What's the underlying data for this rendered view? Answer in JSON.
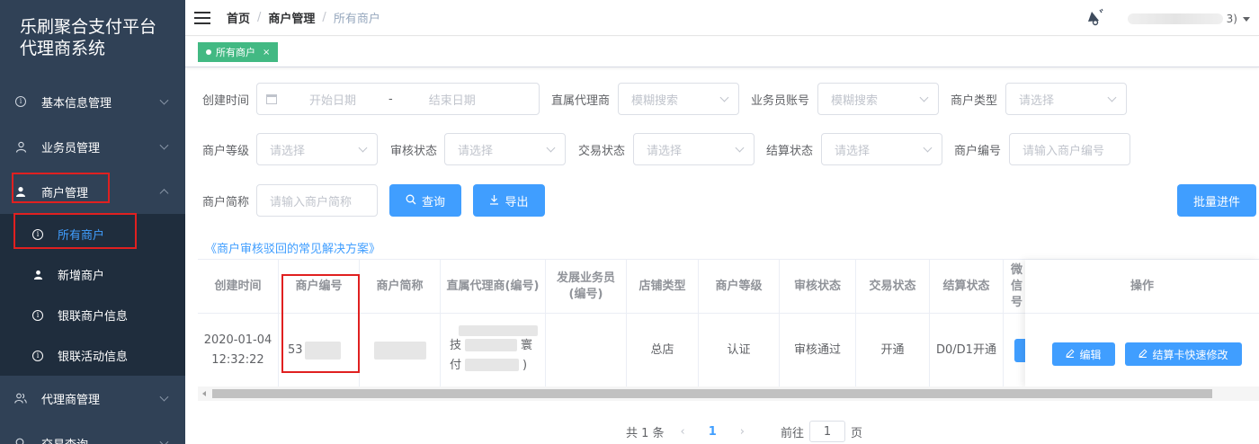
{
  "sidebar": {
    "brand_line1": "乐刷聚合支付平台",
    "brand_line2": "代理商系统",
    "items": [
      {
        "label": "基本信息管理"
      },
      {
        "label": "业务员管理"
      },
      {
        "label": "商户管理"
      },
      {
        "label": "代理商管理"
      },
      {
        "label": "交易查询"
      }
    ],
    "submenu": [
      {
        "label": "所有商户"
      },
      {
        "label": "新增商户"
      },
      {
        "label": "银联商户信息"
      },
      {
        "label": "银联活动信息"
      }
    ]
  },
  "header": {
    "breadcrumb": [
      "首页",
      "商户管理",
      "所有商户"
    ],
    "user_suffix": "3)"
  },
  "tags": [
    {
      "label": "所有商户",
      "close": "×"
    }
  ],
  "filters": {
    "create_time_label": "创建时间",
    "start_placeholder": "开始日期",
    "end_placeholder": "结束日期",
    "range_sep": "-",
    "agent_label": "直属代理商",
    "agent_placeholder": "模糊搜索",
    "salesman_label": "业务员账号",
    "salesman_placeholder": "模糊搜索",
    "merchant_type_label": "商户类型",
    "merchant_type_placeholder": "请选择",
    "level_label": "商户等级",
    "level_placeholder": "请选择",
    "audit_label": "审核状态",
    "audit_placeholder": "请选择",
    "trade_label": "交易状态",
    "trade_placeholder": "请选择",
    "settle_label": "结算状态",
    "settle_placeholder": "请选择",
    "merchant_no_label": "商户编号",
    "merchant_no_placeholder": "请输入商户编号",
    "short_name_label": "商户简称",
    "short_name_placeholder": "请输入商户简称"
  },
  "buttons": {
    "query": "查询",
    "export": "导出",
    "batch": "批量进件"
  },
  "help_link": "《商户审核驳回的常见解决方案》",
  "table": {
    "headers": [
      "创建时间",
      "商户编号",
      "商户简称",
      "直属代理商(编号)",
      "发展业务员(编号)",
      "店铺类型",
      "商户等级",
      "审核状态",
      "交易状态",
      "结算状态",
      "微信号",
      "操作"
    ],
    "row": {
      "create_date": "2020-01-04",
      "create_time": "12:32:22",
      "merchant_no_prefix": "53",
      "agent_part1": "技",
      "agent_part2": "寰",
      "agent_part3": "付",
      "agent_part4": ")",
      "shop_type": "总店",
      "level": "认证",
      "audit": "审核通过",
      "trade": "开通",
      "settle": "D0/D1开通"
    },
    "actions": {
      "edit": "编辑",
      "card_modify": "结算卡快速修改"
    }
  },
  "pager": {
    "total": "共 1 条",
    "current": "1",
    "goto_label": "前往",
    "goto_value": "1",
    "page_unit": "页"
  },
  "colors": {
    "sidebar_bg": "#304156",
    "submenu_bg": "#1f2d3d",
    "primary": "#409eff",
    "tag_green": "#42b983",
    "highlight_red": "#e02020"
  }
}
